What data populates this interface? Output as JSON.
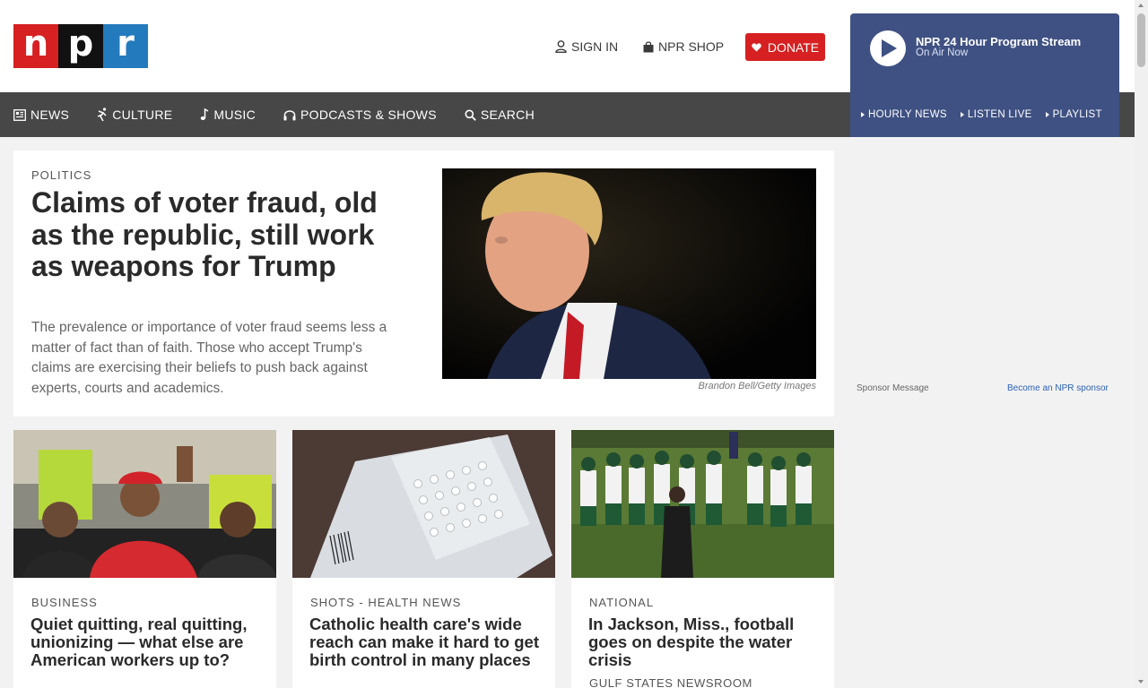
{
  "brand": {
    "letters": [
      "n",
      "p",
      "r"
    ],
    "colors": {
      "red": "#d62021",
      "black": "#111111",
      "blue": "#237bbd"
    }
  },
  "header": {
    "sign_in": "SIGN IN",
    "shop": "NPR SHOP",
    "donate": "DONATE"
  },
  "player": {
    "title": "NPR 24 Hour Program Stream",
    "subtitle": "On Air Now",
    "links": [
      "HOURLY NEWS",
      "LISTEN LIVE",
      "PLAYLIST"
    ]
  },
  "nav": {
    "items": [
      {
        "label": "NEWS",
        "icon": "newspaper-icon"
      },
      {
        "label": "CULTURE",
        "icon": "dancer-icon"
      },
      {
        "label": "MUSIC",
        "icon": "music-note-icon"
      },
      {
        "label": "PODCASTS & SHOWS",
        "icon": "headphones-icon"
      },
      {
        "label": "SEARCH",
        "icon": "search-icon"
      }
    ]
  },
  "featured": {
    "slug": "POLITICS",
    "title": "Claims of voter fraud, old as the republic, still work as weapons for Trump",
    "teaser": "The prevalence or importance of voter fraud seems less a matter of fact than of faith. Those who accept Trump's claims are exercising their beliefs to push back against experts, courts and academics.",
    "credit": "Brandon Bell/Getty Images"
  },
  "sponsor": {
    "label": "Sponsor Message",
    "link": "Become an NPR sponsor"
  },
  "cards": [
    {
      "slug": "BUSINESS",
      "title": "Quiet quitting, real quitting, unionizing — what else are American workers up to?"
    },
    {
      "slug": "SHOTS - HEALTH NEWS",
      "title": "Catholic health care's wide reach can make it hard to get birth control in many places"
    },
    {
      "slug": "NATIONAL",
      "title": "In Jackson, Miss., football goes on despite the water crisis",
      "source": "GULF STATES NEWSROOM"
    }
  ]
}
